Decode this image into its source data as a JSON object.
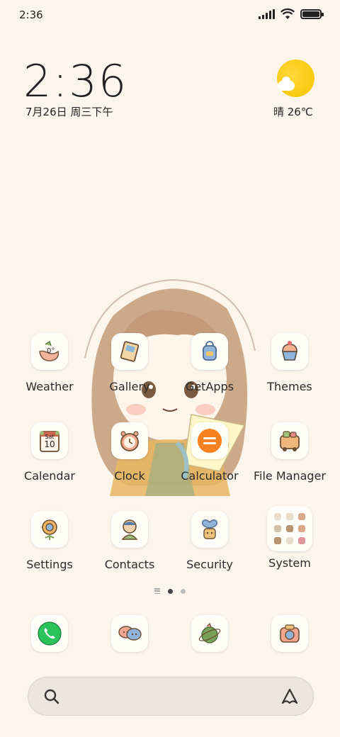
{
  "status_bar": {
    "time": "2:36"
  },
  "clock_widget": {
    "time": "2:36",
    "date": "7月26日 周三下午"
  },
  "weather_widget": {
    "condition_temp": "晴 26℃"
  },
  "apps_row1": [
    {
      "label": "Weather",
      "icon": "weather-icon"
    },
    {
      "label": "Gallery",
      "icon": "gallery-icon"
    },
    {
      "label": "GetApps",
      "icon": "getapps-icon"
    },
    {
      "label": "Themes",
      "icon": "themes-icon"
    }
  ],
  "apps_row2": [
    {
      "label": "Calendar",
      "icon": "calendar-icon",
      "day": "Sat",
      "date": "10"
    },
    {
      "label": "Clock",
      "icon": "clock-icon"
    },
    {
      "label": "Calculator",
      "icon": "calculator-icon"
    },
    {
      "label": "File Manager",
      "icon": "file-manager-icon"
    }
  ],
  "apps_row3": [
    {
      "label": "Settings",
      "icon": "settings-icon"
    },
    {
      "label": "Contacts",
      "icon": "contacts-icon"
    },
    {
      "label": "Security",
      "icon": "security-icon"
    },
    {
      "label": "System",
      "icon": "folder-icon"
    }
  ],
  "weather_icon_text": "0°",
  "dock": [
    {
      "icon": "phone-icon"
    },
    {
      "icon": "messages-icon"
    },
    {
      "icon": "browser-icon"
    },
    {
      "icon": "camera-icon"
    }
  ],
  "page_indicator": {
    "pages": 2,
    "active": 1
  },
  "colors": {
    "background": "#fbf5ec",
    "phone_green": "#2bc45a",
    "calculator_orange": "#f4801f"
  }
}
